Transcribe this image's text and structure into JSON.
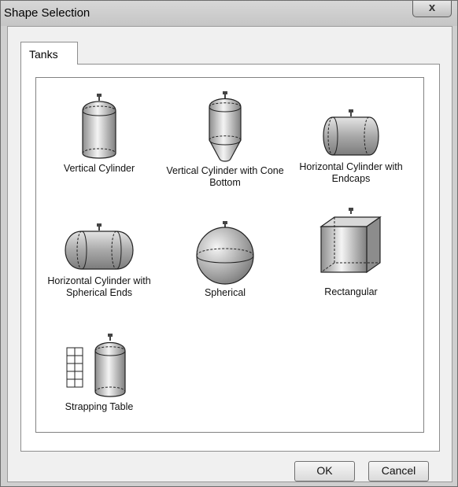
{
  "window": {
    "title": "Shape Selection",
    "close_glyph": "x"
  },
  "tabs": [
    {
      "label": "Tanks"
    }
  ],
  "shapes": [
    {
      "id": "vertical-cylinder",
      "label": "Vertical Cylinder",
      "icon": "vertical-cylinder-icon"
    },
    {
      "id": "vertical-cylinder-cone",
      "label": "Vertical Cylinder with Cone Bottom",
      "icon": "vertical-cylinder-cone-bottom-icon"
    },
    {
      "id": "horizontal-cylinder-endcaps",
      "label": "Horizontal Cylinder with Endcaps",
      "icon": "horizontal-cylinder-endcaps-icon"
    },
    {
      "id": "horizontal-cylinder-spherical",
      "label": "Horizontal Cylinder with Spherical Ends",
      "icon": "horizontal-cylinder-spherical-ends-icon"
    },
    {
      "id": "spherical",
      "label": "Spherical",
      "icon": "sphere-icon"
    },
    {
      "id": "rectangular",
      "label": "Rectangular",
      "icon": "rectangular-box-icon"
    },
    {
      "id": "strapping-table",
      "label": "Strapping Table",
      "icon": "strapping-table-icon"
    }
  ],
  "buttons": {
    "ok": "OK",
    "cancel": "Cancel"
  }
}
